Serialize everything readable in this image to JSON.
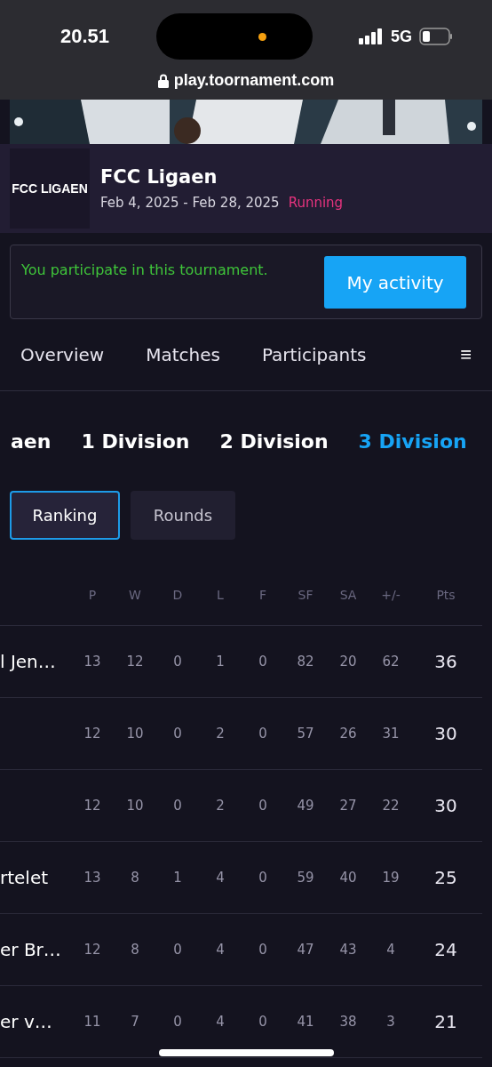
{
  "status_bar": {
    "time": "20.51",
    "network": "5G"
  },
  "browser": {
    "url": "play.toornament.com"
  },
  "tournament": {
    "logo_text": "FCC LIGAEN",
    "name": "FCC Ligaen",
    "dates": "Feb 4, 2025 - Feb 28, 2025",
    "status": "Running"
  },
  "notice": {
    "text": "You participate in this tournament.",
    "button": "My activity"
  },
  "tabs": [
    {
      "label": "Overview",
      "selected": false
    },
    {
      "label": "Matches",
      "selected": false
    },
    {
      "label": "Participants",
      "selected": false
    }
  ],
  "menu_icon": "≡",
  "divisions": [
    {
      "label": "aen",
      "selected": false
    },
    {
      "label": "1 Division",
      "selected": false
    },
    {
      "label": "2 Division",
      "selected": false
    },
    {
      "label": "3 Division",
      "selected": true
    }
  ],
  "views": [
    {
      "label": "Ranking",
      "selected": true
    },
    {
      "label": "Rounds",
      "selected": false
    }
  ],
  "table": {
    "columns": [
      "P",
      "W",
      "D",
      "L",
      "F",
      "SF",
      "SA",
      "+/-",
      "Pts"
    ],
    "rows": [
      {
        "team": "l Jen…",
        "cells": [
          "13",
          "12",
          "0",
          "1",
          "0",
          "82",
          "20",
          "62",
          "36"
        ]
      },
      {
        "cells": [
          "12",
          "10",
          "0",
          "2",
          "0",
          "57",
          "26",
          "31",
          "30"
        ]
      },
      {
        "cells": [
          "12",
          "10",
          "0",
          "2",
          "0",
          "49",
          "27",
          "22",
          "30"
        ]
      },
      {
        "team": "rtelet",
        "cells": [
          "13",
          "8",
          "1",
          "4",
          "0",
          "59",
          "40",
          "19",
          "25"
        ]
      },
      {
        "team": "er Br…",
        "cells": [
          "12",
          "8",
          "0",
          "4",
          "0",
          "47",
          "43",
          "4",
          "24"
        ]
      },
      {
        "team": "er v…",
        "cells": [
          "11",
          "7",
          "0",
          "4",
          "0",
          "41",
          "38",
          "3",
          "21"
        ]
      }
    ]
  }
}
